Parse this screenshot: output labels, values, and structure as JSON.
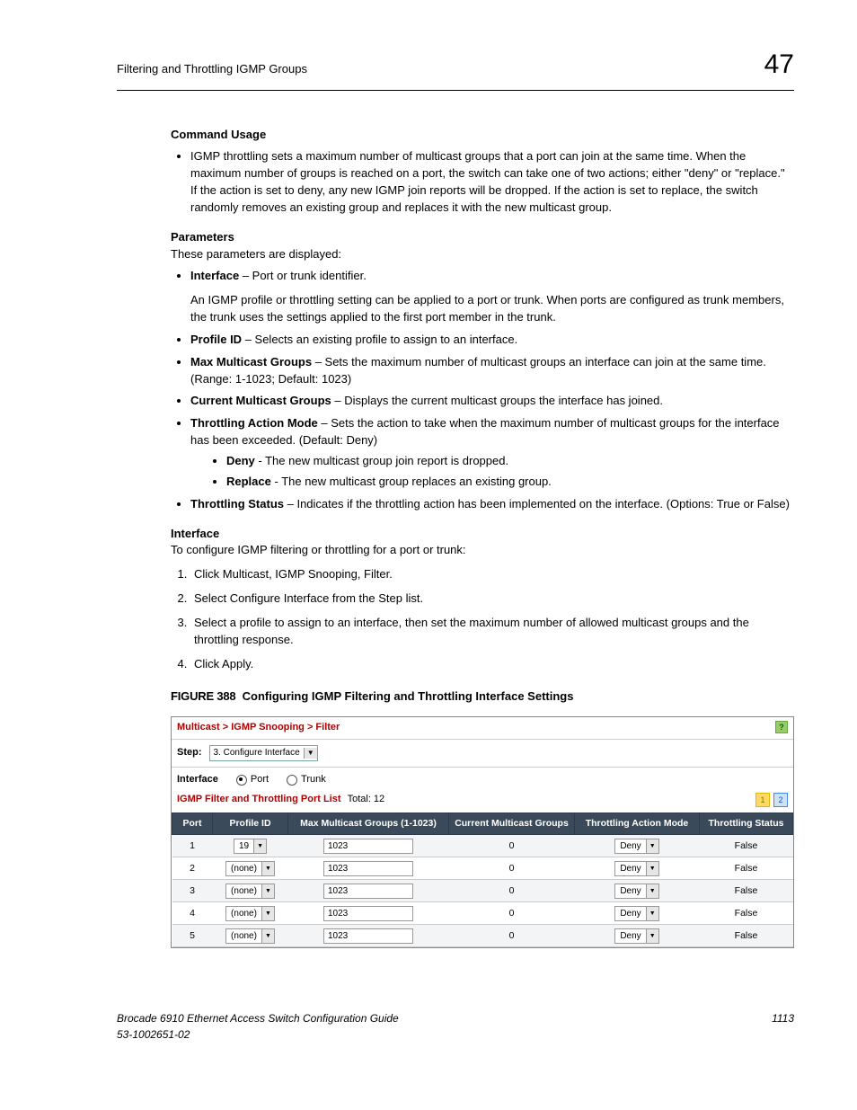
{
  "header": {
    "title": "Filtering and Throttling IGMP Groups",
    "chapter": "47"
  },
  "sections": {
    "cmd_usage": {
      "h": "Command Usage",
      "bullet1": "IGMP throttling sets a maximum number of multicast groups that a port can join at the same time. When the maximum number of groups is reached on a port, the switch can take one of two actions; either \"deny\" or \"replace.\" If the action is set to deny, any new IGMP join reports will be dropped. If the action is set to replace, the switch randomly removes an existing group and replaces it with the new multicast group."
    },
    "params": {
      "h": "Parameters",
      "intro": "These parameters are displayed:",
      "iface_term": "Interface",
      "iface_desc": " – Port or trunk identifier.",
      "iface_note": "An IGMP profile or throttling setting can be applied to a port or trunk. When ports are configured as trunk members, the trunk uses the settings applied to the first port member in the trunk.",
      "pid_term": "Profile ID",
      "pid_desc": " – Selects an existing profile to assign to an interface.",
      "max_term": "Max Multicast Groups",
      "max_desc": " – Sets the maximum number of multicast groups an interface can join at the same time. (Range: 1-1023; Default: 1023)",
      "cur_term": "Current Multicast Groups",
      "cur_desc": " – Displays the current multicast groups the interface has joined.",
      "tam_term": "Throttling Action Mode",
      "tam_desc": " – Sets the action to take when the maximum number of multicast groups for the interface has been exceeded. (Default: Deny)",
      "deny_term": "Deny",
      "deny_desc": " - The new multicast group join report is dropped.",
      "rep_term": "Replace",
      "rep_desc": " - The new multicast group replaces an existing group.",
      "ts_term": "Throttling Status",
      "ts_desc": " – Indicates if the throttling action has been implemented on the interface. (Options: True or False)"
    },
    "iface_section": {
      "h": "Interface",
      "intro": "To configure IGMP filtering or throttling for a port or trunk:",
      "s1": "Click Multicast, IGMP Snooping, Filter.",
      "s2": "Select Configure Interface from the Step list.",
      "s3": "Select a profile to assign to an interface, then set the maximum number of allowed multicast groups and the throttling response.",
      "s4": "Click Apply."
    },
    "figure": {
      "label": "FIGURE 388",
      "text": "Configuring IGMP Filtering and Throttling Interface Settings"
    }
  },
  "screenshot": {
    "crumb": "Multicast > IGMP Snooping > Filter",
    "help": "?",
    "step_label": "Step:",
    "step_value": "3. Configure Interface",
    "iface_label": "Interface",
    "radio_port": "Port",
    "radio_trunk": "Trunk",
    "list_title": "IGMP Filter and Throttling Port List",
    "list_total": "Total: 12",
    "page1": "1",
    "page2": "2",
    "cols": {
      "port": "Port",
      "pid": "Profile ID",
      "max": "Max Multicast Groups (1-1023)",
      "cur": "Current Multicast Groups",
      "tam": "Throttling Action Mode",
      "ts": "Throttling Status"
    },
    "rows": [
      {
        "port": "1",
        "pid": "19",
        "max": "1023",
        "cur": "0",
        "tam": "Deny",
        "ts": "False"
      },
      {
        "port": "2",
        "pid": "(none)",
        "max": "1023",
        "cur": "0",
        "tam": "Deny",
        "ts": "False"
      },
      {
        "port": "3",
        "pid": "(none)",
        "max": "1023",
        "cur": "0",
        "tam": "Deny",
        "ts": "False"
      },
      {
        "port": "4",
        "pid": "(none)",
        "max": "1023",
        "cur": "0",
        "tam": "Deny",
        "ts": "False"
      },
      {
        "port": "5",
        "pid": "(none)",
        "max": "1023",
        "cur": "0",
        "tam": "Deny",
        "ts": "False"
      }
    ]
  },
  "footer": {
    "left1": "Brocade 6910 Ethernet Access Switch Configuration Guide",
    "left2": "53-1002651-02",
    "right": "1113"
  }
}
